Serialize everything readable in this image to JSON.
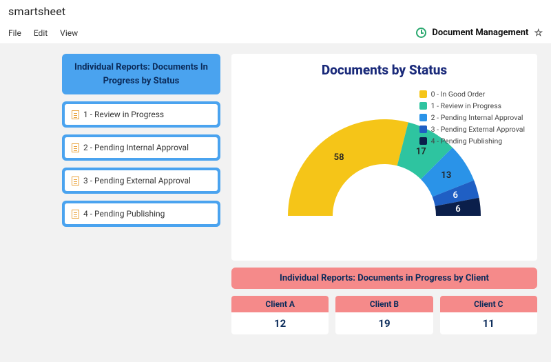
{
  "brand": "smartsheet",
  "menu": {
    "file": "File",
    "edit": "Edit",
    "view": "View"
  },
  "page": {
    "title": "Document Management"
  },
  "sidebar": {
    "header": "Individual Reports: Documents In Progress by Status",
    "items": [
      {
        "label": "1 - Review in Progress"
      },
      {
        "label": "2 - Pending Internal Approval"
      },
      {
        "label": "3 - Pending External Approval"
      },
      {
        "label": "4 - Pending Publishing"
      }
    ]
  },
  "chart": {
    "title": "Documents by Status",
    "legend": [
      {
        "label": "0 - In Good Order",
        "color": "#f5c518"
      },
      {
        "label": "1 - Review in Progress",
        "color": "#2ec4a0"
      },
      {
        "label": "2 - Pending Internal Approval",
        "color": "#2a93e8"
      },
      {
        "label": "3 - Pending External Approval",
        "color": "#1f5fc4"
      },
      {
        "label": "4 - Pending Publishing",
        "color": "#0b1f4b"
      }
    ]
  },
  "clients": {
    "header": "Individual Reports: Documents in Progress by Client",
    "cols": [
      {
        "name": "Client A",
        "value": "12"
      },
      {
        "name": "Client B",
        "value": "19"
      },
      {
        "name": "Client C",
        "value": "11"
      }
    ]
  },
  "chart_data": {
    "type": "pie",
    "title": "Documents by Status",
    "semicircle": true,
    "series": [
      {
        "name": "0 - In Good Order",
        "value": 58,
        "color": "#f5c518"
      },
      {
        "name": "1 - Review in Progress",
        "value": 17,
        "color": "#2ec4a0"
      },
      {
        "name": "2 - Pending Internal Approval",
        "value": 13,
        "color": "#2a93e8"
      },
      {
        "name": "3 - Pending External Approval",
        "value": 6,
        "color": "#1f5fc4"
      },
      {
        "name": "4 - Pending Publishing",
        "value": 6,
        "color": "#0b1f4b"
      }
    ]
  }
}
